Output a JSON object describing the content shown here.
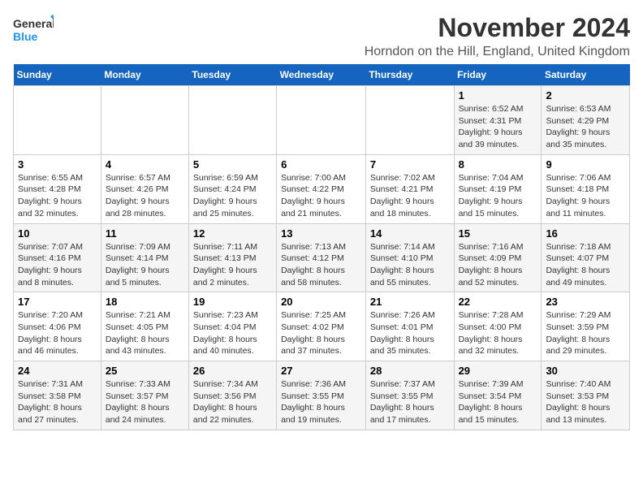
{
  "logo": {
    "line1": "General",
    "line2": "Blue"
  },
  "title": "November 2024",
  "location": "Horndon on the Hill, England, United Kingdom",
  "days_of_week": [
    "Sunday",
    "Monday",
    "Tuesday",
    "Wednesday",
    "Thursday",
    "Friday",
    "Saturday"
  ],
  "weeks": [
    [
      {
        "day": "",
        "detail": ""
      },
      {
        "day": "",
        "detail": ""
      },
      {
        "day": "",
        "detail": ""
      },
      {
        "day": "",
        "detail": ""
      },
      {
        "day": "",
        "detail": ""
      },
      {
        "day": "1",
        "detail": "Sunrise: 6:52 AM\nSunset: 4:31 PM\nDaylight: 9 hours and 39 minutes."
      },
      {
        "day": "2",
        "detail": "Sunrise: 6:53 AM\nSunset: 4:29 PM\nDaylight: 9 hours and 35 minutes."
      }
    ],
    [
      {
        "day": "3",
        "detail": "Sunrise: 6:55 AM\nSunset: 4:28 PM\nDaylight: 9 hours and 32 minutes."
      },
      {
        "day": "4",
        "detail": "Sunrise: 6:57 AM\nSunset: 4:26 PM\nDaylight: 9 hours and 28 minutes."
      },
      {
        "day": "5",
        "detail": "Sunrise: 6:59 AM\nSunset: 4:24 PM\nDaylight: 9 hours and 25 minutes."
      },
      {
        "day": "6",
        "detail": "Sunrise: 7:00 AM\nSunset: 4:22 PM\nDaylight: 9 hours and 21 minutes."
      },
      {
        "day": "7",
        "detail": "Sunrise: 7:02 AM\nSunset: 4:21 PM\nDaylight: 9 hours and 18 minutes."
      },
      {
        "day": "8",
        "detail": "Sunrise: 7:04 AM\nSunset: 4:19 PM\nDaylight: 9 hours and 15 minutes."
      },
      {
        "day": "9",
        "detail": "Sunrise: 7:06 AM\nSunset: 4:18 PM\nDaylight: 9 hours and 11 minutes."
      }
    ],
    [
      {
        "day": "10",
        "detail": "Sunrise: 7:07 AM\nSunset: 4:16 PM\nDaylight: 9 hours and 8 minutes."
      },
      {
        "day": "11",
        "detail": "Sunrise: 7:09 AM\nSunset: 4:14 PM\nDaylight: 9 hours and 5 minutes."
      },
      {
        "day": "12",
        "detail": "Sunrise: 7:11 AM\nSunset: 4:13 PM\nDaylight: 9 hours and 2 minutes."
      },
      {
        "day": "13",
        "detail": "Sunrise: 7:13 AM\nSunset: 4:12 PM\nDaylight: 8 hours and 58 minutes."
      },
      {
        "day": "14",
        "detail": "Sunrise: 7:14 AM\nSunset: 4:10 PM\nDaylight: 8 hours and 55 minutes."
      },
      {
        "day": "15",
        "detail": "Sunrise: 7:16 AM\nSunset: 4:09 PM\nDaylight: 8 hours and 52 minutes."
      },
      {
        "day": "16",
        "detail": "Sunrise: 7:18 AM\nSunset: 4:07 PM\nDaylight: 8 hours and 49 minutes."
      }
    ],
    [
      {
        "day": "17",
        "detail": "Sunrise: 7:20 AM\nSunset: 4:06 PM\nDaylight: 8 hours and 46 minutes."
      },
      {
        "day": "18",
        "detail": "Sunrise: 7:21 AM\nSunset: 4:05 PM\nDaylight: 8 hours and 43 minutes."
      },
      {
        "day": "19",
        "detail": "Sunrise: 7:23 AM\nSunset: 4:04 PM\nDaylight: 8 hours and 40 minutes."
      },
      {
        "day": "20",
        "detail": "Sunrise: 7:25 AM\nSunset: 4:02 PM\nDaylight: 8 hours and 37 minutes."
      },
      {
        "day": "21",
        "detail": "Sunrise: 7:26 AM\nSunset: 4:01 PM\nDaylight: 8 hours and 35 minutes."
      },
      {
        "day": "22",
        "detail": "Sunrise: 7:28 AM\nSunset: 4:00 PM\nDaylight: 8 hours and 32 minutes."
      },
      {
        "day": "23",
        "detail": "Sunrise: 7:29 AM\nSunset: 3:59 PM\nDaylight: 8 hours and 29 minutes."
      }
    ],
    [
      {
        "day": "24",
        "detail": "Sunrise: 7:31 AM\nSunset: 3:58 PM\nDaylight: 8 hours and 27 minutes."
      },
      {
        "day": "25",
        "detail": "Sunrise: 7:33 AM\nSunset: 3:57 PM\nDaylight: 8 hours and 24 minutes."
      },
      {
        "day": "26",
        "detail": "Sunrise: 7:34 AM\nSunset: 3:56 PM\nDaylight: 8 hours and 22 minutes."
      },
      {
        "day": "27",
        "detail": "Sunrise: 7:36 AM\nSunset: 3:55 PM\nDaylight: 8 hours and 19 minutes."
      },
      {
        "day": "28",
        "detail": "Sunrise: 7:37 AM\nSunset: 3:55 PM\nDaylight: 8 hours and 17 minutes."
      },
      {
        "day": "29",
        "detail": "Sunrise: 7:39 AM\nSunset: 3:54 PM\nDaylight: 8 hours and 15 minutes."
      },
      {
        "day": "30",
        "detail": "Sunrise: 7:40 AM\nSunset: 3:53 PM\nDaylight: 8 hours and 13 minutes."
      }
    ]
  ]
}
